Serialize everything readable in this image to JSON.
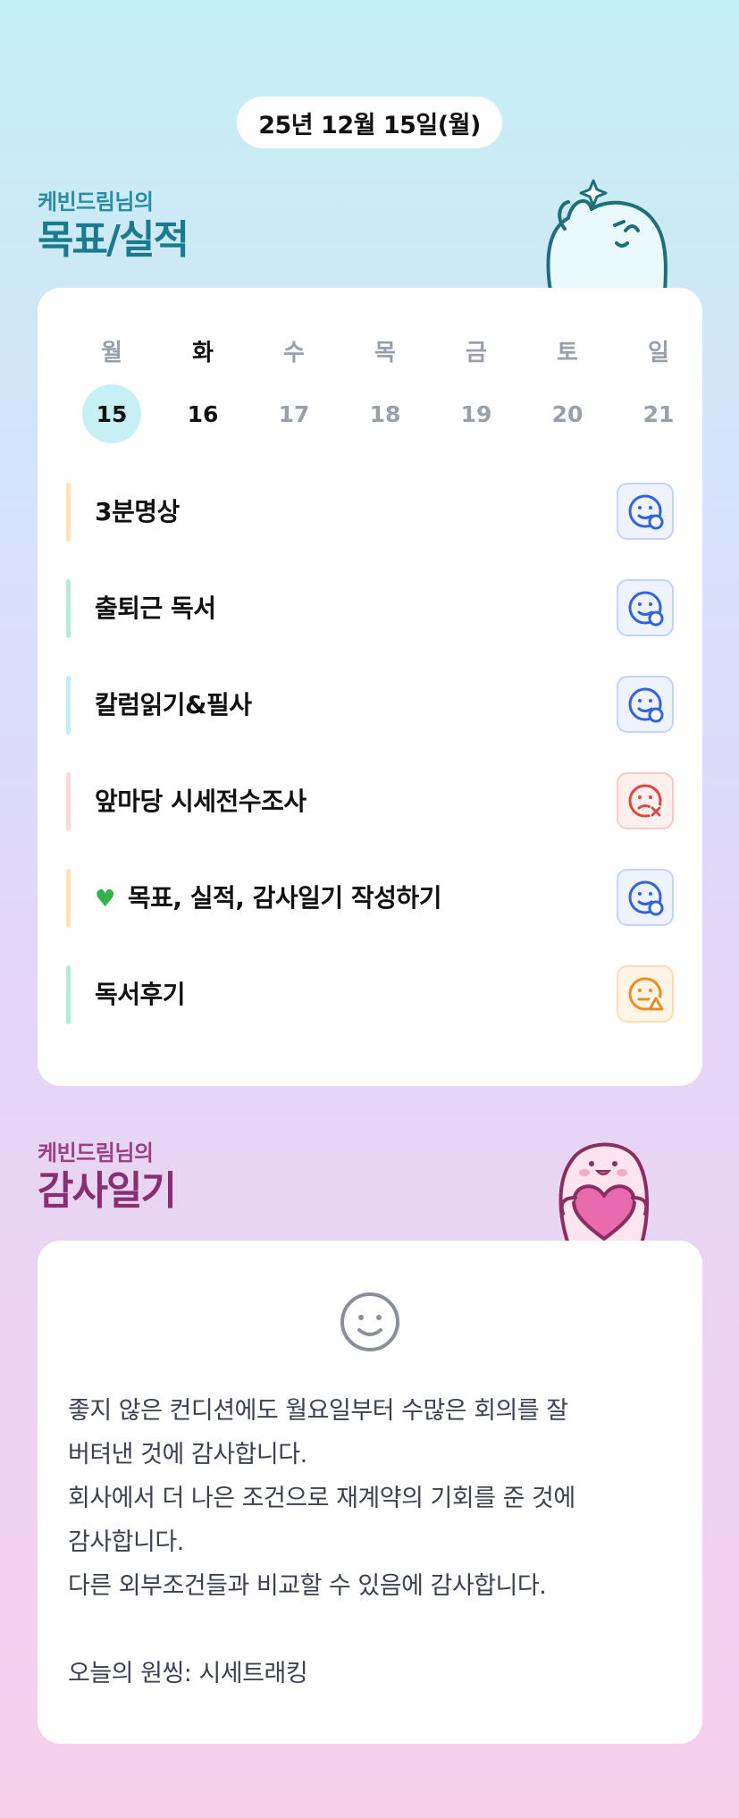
{
  "header": {
    "date_label": "25년 12월 15일(월)"
  },
  "goals_section": {
    "subtitle": "케빈드림님의",
    "title": "목표/실적"
  },
  "week": {
    "days": [
      "월",
      "화",
      "수",
      "목",
      "금",
      "토",
      "일"
    ],
    "dates": [
      "15",
      "16",
      "17",
      "18",
      "19",
      "20",
      "21"
    ],
    "selected_index": 0
  },
  "goals": [
    {
      "label": "3분명상",
      "bar_color": "#fde3b4",
      "status": "done-icon"
    },
    {
      "label": "출퇴근 독서",
      "bar_color": "#b4ecd9",
      "status": "done-icon"
    },
    {
      "label": "칼럼읽기&필사",
      "bar_color": "#bfeef3",
      "status": "done-icon"
    },
    {
      "label": "앞마당 시세전수조사",
      "bar_color": "#fdd8d8",
      "status": "failed-icon"
    },
    {
      "label": "목표, 실적, 감사일기 작성하기",
      "bar_color": "#fde3b4",
      "status": "done-icon",
      "prefix_icon": "green-heart-icon"
    },
    {
      "label": "독서후기",
      "bar_color": "#b4ecd9",
      "status": "warning-icon"
    }
  ],
  "gratitude_section": {
    "subtitle": "케빈드림님의",
    "title": "감사일기",
    "mood_icon": "smile-face-icon",
    "lines": [
      "좋지 않은 컨디션에도 월요일부터 수많은 회의를 잘",
      "버텨낸 것에 감사합니다.",
      "회사에서 더 나은 조건으로 재계약의 기회를 준 것에",
      "감사합니다.",
      "다른 외부조건들과 비교할 수 있음에 감사합니다.",
      "",
      "오늘의 원씽: 시세트래킹"
    ]
  },
  "colors": {
    "done": "#2f63e6",
    "failed": "#e0473a",
    "warning": "#f08a1c",
    "goal_title": "#1a7a8e",
    "gratitude_title": "#8a2e72",
    "today_circle": "#c6f0f3"
  }
}
